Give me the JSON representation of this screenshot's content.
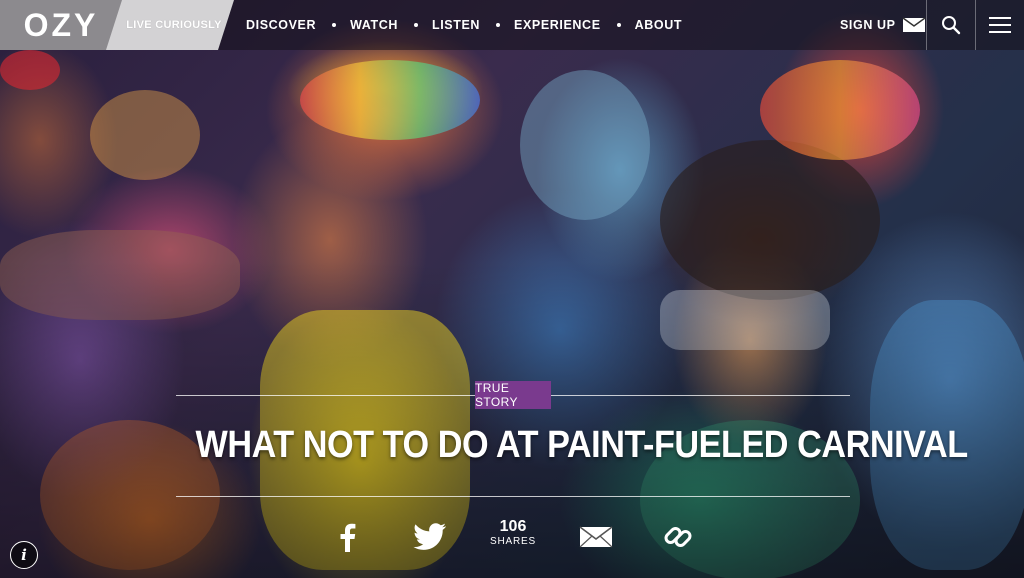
{
  "brand": {
    "logo": "OZY",
    "tagline": "LIVE CURIOUSLY"
  },
  "nav": {
    "items": [
      "DISCOVER",
      "WATCH",
      "LISTEN",
      "EXPERIENCE",
      "ABOUT"
    ]
  },
  "header": {
    "signup_label": "SIGN UP",
    "icons": [
      "mail-icon",
      "search-icon",
      "menu-icon"
    ]
  },
  "article": {
    "category": "TRUE STORY",
    "title": "WHAT NOT TO DO AT PAINT-FUELED CARNIVAL",
    "share_count": "106",
    "share_label": "SHARES",
    "share_icons": [
      "facebook-icon",
      "twitter-icon",
      "email-icon",
      "link-icon"
    ]
  },
  "colors": {
    "accent": "#7a3a8e",
    "logo_bg": "#8c8a8e",
    "tagline_bg": "#d3d2d4"
  }
}
